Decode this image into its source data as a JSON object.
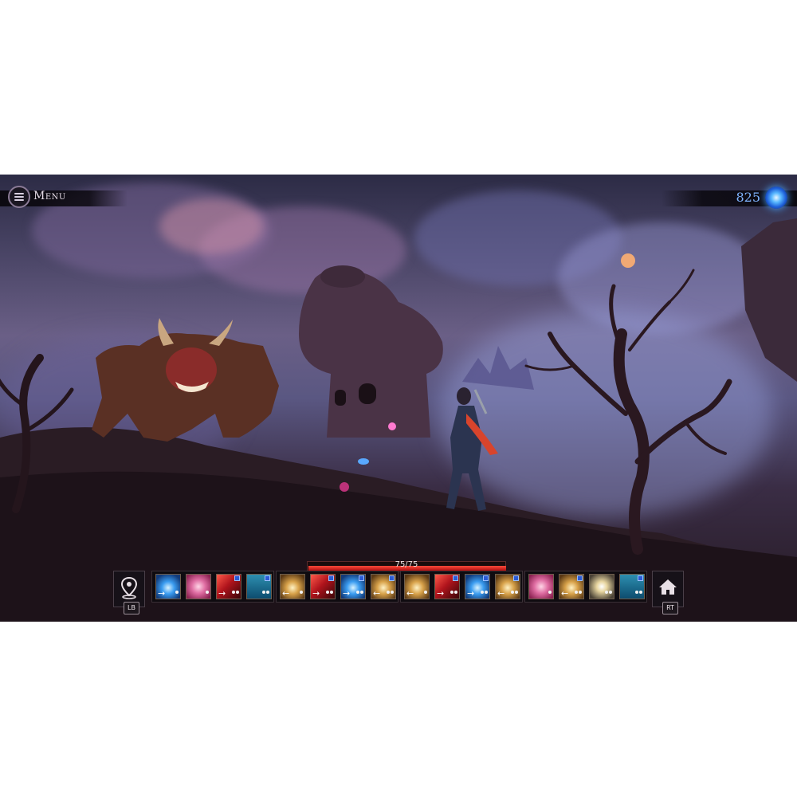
{
  "hud": {
    "menu_label": "Menu",
    "currency_value": "825",
    "health_text": "75/75",
    "health_fraction": 1.0,
    "map_button_tag": "LB",
    "home_button_tag": "RT"
  },
  "skillbar": {
    "groups": [
      [
        {
          "icon": "lightning",
          "mod": "→",
          "dots": 1,
          "badge": false
        },
        {
          "icon": "rose",
          "mod": "",
          "dots": 1,
          "badge": false
        },
        {
          "icon": "fire-slash",
          "mod": "→",
          "dots": 2,
          "badge": true
        },
        {
          "icon": "ice-arrows",
          "mod": "",
          "dots": 2,
          "badge": true
        }
      ],
      [
        {
          "icon": "golden-strike",
          "mod": "←",
          "dots": 1,
          "badge": false
        },
        {
          "icon": "fire-slash",
          "mod": "→",
          "dots": 2,
          "badge": true
        },
        {
          "icon": "lightning",
          "mod": "→",
          "dots": 2,
          "badge": true
        },
        {
          "icon": "golden-burst",
          "mod": "←",
          "dots": 2,
          "badge": true
        }
      ],
      [
        {
          "icon": "golden-strike",
          "mod": "←",
          "dots": 1,
          "badge": false
        },
        {
          "icon": "fire-slash",
          "mod": "→",
          "dots": 2,
          "badge": true
        },
        {
          "icon": "lightning",
          "mod": "→",
          "dots": 2,
          "badge": true
        },
        {
          "icon": "golden-burst",
          "mod": "←",
          "dots": 2,
          "badge": true
        }
      ],
      [
        {
          "icon": "rose",
          "mod": "",
          "dots": 1,
          "badge": false
        },
        {
          "icon": "golden-burst",
          "mod": "←",
          "dots": 2,
          "badge": true
        },
        {
          "icon": "white-light",
          "mod": "",
          "dots": 2,
          "badge": false
        },
        {
          "icon": "ice-arrows",
          "mod": "",
          "dots": 2,
          "badge": true
        }
      ]
    ]
  },
  "colors": {
    "health": "#d62a1e",
    "currency": "#4aa4ff",
    "menu_text": "#e6dde8"
  }
}
